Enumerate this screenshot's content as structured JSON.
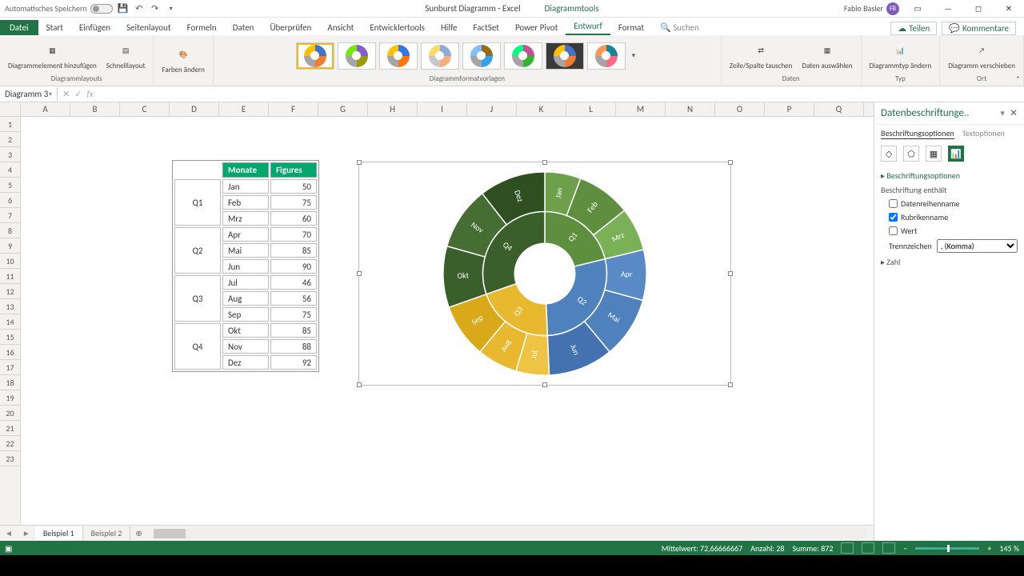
{
  "title": {
    "autosave": "Automatisches Speichern",
    "doc": "Sunburst Diagramm - Excel",
    "tools": "Diagrammtools",
    "user": "Fabio Basler",
    "avatar": "FB"
  },
  "tabs": {
    "file": "Datei",
    "start": "Start",
    "einf": "Einfügen",
    "layout": "Seitenlayout",
    "formeln": "Formeln",
    "daten": "Daten",
    "review": "Überprüfen",
    "ansicht": "Ansicht",
    "dev": "Entwicklertools",
    "hilfe": "Hilfe",
    "factset": "FactSet",
    "ppivot": "Power Pivot",
    "entwurf": "Entwurf",
    "format": "Format",
    "suchen": "Suchen",
    "teilen": "Teilen",
    "kommentare": "Kommentare"
  },
  "ribbon": {
    "groups": {
      "layouts": "Diagrammlayouts",
      "styles": "Diagrammformatvorlagen",
      "daten": "Daten",
      "typ": "Typ",
      "ort": "Ort"
    },
    "btns": {
      "addel": "Diagrammelement hinzufügen",
      "schnell": "Schnelllayout",
      "farben": "Farben ändern",
      "zeile": "Zeile/Spalte tauschen",
      "ausw": "Daten auswählen",
      "typ": "Diagrammtyp ändern",
      "versch": "Diagramm verschieben"
    }
  },
  "namebox": "Diagramm 3",
  "cols": [
    "A",
    "B",
    "C",
    "D",
    "E",
    "F",
    "G",
    "H",
    "I",
    "J",
    "K",
    "L",
    "M",
    "N",
    "O",
    "P",
    "Q"
  ],
  "rows": [
    1,
    2,
    3,
    4,
    5,
    6,
    7,
    8,
    9,
    10,
    11,
    12,
    13,
    14,
    15,
    16,
    17,
    18,
    19,
    20,
    21,
    22,
    23
  ],
  "table": {
    "h1": "Monate",
    "h2": "Figures",
    "q": [
      "Q1",
      "Q2",
      "Q3",
      "Q4"
    ],
    "rows": [
      {
        "m": "Jan",
        "v": 50
      },
      {
        "m": "Feb",
        "v": 75
      },
      {
        "m": "Mrz",
        "v": 60
      },
      {
        "m": "Apr",
        "v": 70
      },
      {
        "m": "Mai",
        "v": 85
      },
      {
        "m": "Jun",
        "v": 90
      },
      {
        "m": "Jul",
        "v": 46
      },
      {
        "m": "Aug",
        "v": 56
      },
      {
        "m": "Sep",
        "v": 75
      },
      {
        "m": "Okt",
        "v": 85
      },
      {
        "m": "Nov",
        "v": 88
      },
      {
        "m": "Dez",
        "v": 92
      }
    ]
  },
  "chart_data": {
    "type": "pie",
    "title": "",
    "inner": [
      {
        "label": "Q1",
        "value": 185,
        "color": "#5d8f3f"
      },
      {
        "label": "Q2",
        "value": 245,
        "color": "#4f81bd"
      },
      {
        "label": "Q3",
        "value": 177,
        "color": "#e8b92f"
      },
      {
        "label": "Q4",
        "value": 265,
        "color": "#3a5f2a"
      }
    ],
    "outer": [
      {
        "q": "Q1",
        "label": "Jan",
        "value": 50,
        "color": "#6ea04b"
      },
      {
        "q": "Q1",
        "label": "Feb",
        "value": 75,
        "color": "#5d8f3f"
      },
      {
        "q": "Q1",
        "label": "Mrz",
        "value": 60,
        "color": "#7ab157"
      },
      {
        "q": "Q2",
        "label": "Apr",
        "value": 70,
        "color": "#5a8ac6"
      },
      {
        "q": "Q2",
        "label": "Mai",
        "value": 85,
        "color": "#4f81bd"
      },
      {
        "q": "Q2",
        "label": "Jun",
        "value": 90,
        "color": "#4472b0"
      },
      {
        "q": "Q3",
        "label": "Jul",
        "value": 46,
        "color": "#eec445"
      },
      {
        "q": "Q3",
        "label": "Aug",
        "value": 56,
        "color": "#e8b92f"
      },
      {
        "q": "Q3",
        "label": "Sep",
        "value": 75,
        "color": "#d9a91a"
      },
      {
        "q": "Q4",
        "label": "Okt",
        "value": 85,
        "color": "#3a5f2a"
      },
      {
        "q": "Q4",
        "label": "Nov",
        "value": 88,
        "color": "#466d33"
      },
      {
        "q": "Q4",
        "label": "Dez",
        "value": 92,
        "color": "#2f4f21"
      }
    ]
  },
  "pane": {
    "title": "Datenbeschriftunge..",
    "sub1": "Beschriftungsoptionen",
    "sub2": "Textoptionen",
    "sec": "Beschriftungsoptionen",
    "sub": "Beschriftung enthält",
    "c1": "Datenreihenname",
    "c2": "Rubrikenname",
    "c3": "Wert",
    "trenn": "Trennzeichen",
    "trennval": ", (Komma)",
    "zahl": "Zahl"
  },
  "sheets": {
    "s1": "Beispiel 1",
    "s2": "Beispiel 2"
  },
  "status": {
    "mw": "Mittelwert: 72,66666667",
    "anz": "Anzahl: 28",
    "sum": "Summe: 872",
    "zoom": "145 %"
  }
}
